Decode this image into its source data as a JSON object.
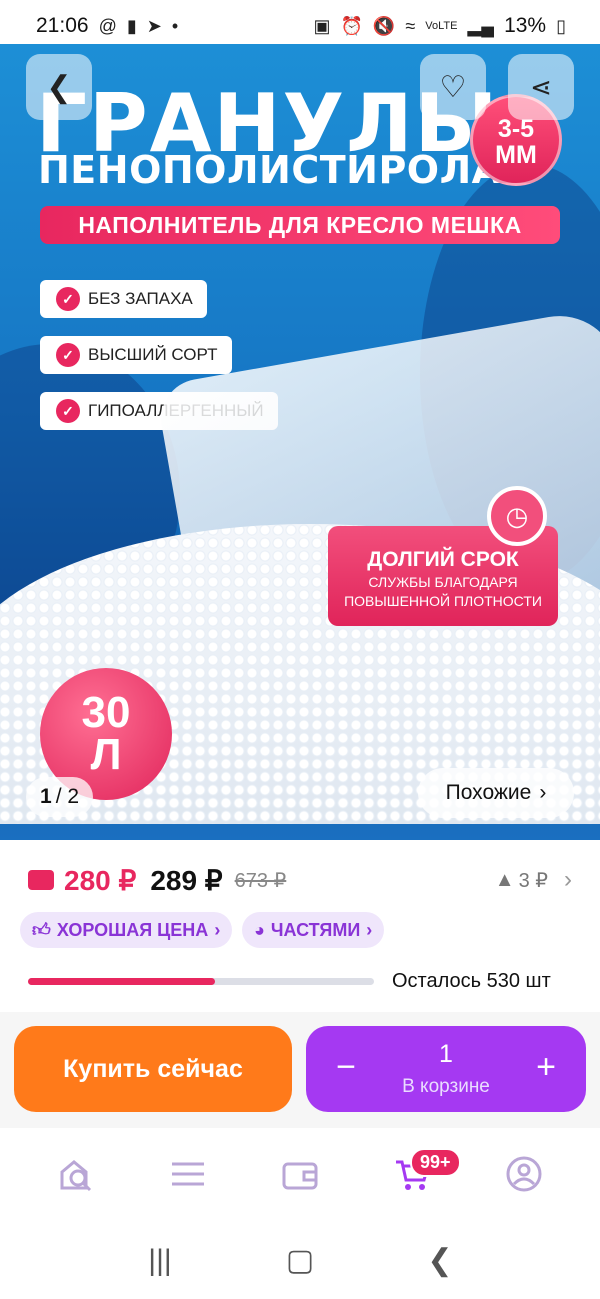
{
  "status_bar": {
    "time": "21:06",
    "battery": "13%",
    "icons_left": [
      "at-icon",
      "alert-icon",
      "telegram-icon",
      "dot-icon"
    ],
    "icons_right": [
      "battery-saver-icon",
      "alarm-icon",
      "mute-icon",
      "wifi-icon",
      "volte-icon",
      "signal-icon",
      "battery-icon"
    ]
  },
  "hero": {
    "title_line1": "ГРАНУЛЫ",
    "title_line2": "ПЕНОПОЛИСТИРОЛА",
    "size_badge": "3-5\nММ",
    "size_line1": "3-5",
    "size_line2": "ММ",
    "filler_banner": "НАПОЛНИТЕЛЬ ДЛЯ КРЕСЛО МЕШКА",
    "features": [
      "БЕЗ ЗАПАХА",
      "ВЫСШИЙ СОРТ",
      "ГИПОАЛЛЕРГЕННЫЙ"
    ],
    "long_title": "ДОЛГИЙ СРОК",
    "long_sub1": "СЛУЖБЫ БЛАГОДАРЯ",
    "long_sub2": "ПОВЫШЕННОЙ ПЛОТНОСТИ",
    "volume_num": "30",
    "volume_unit": "Л",
    "pager_current": "1",
    "pager_total": "/ 2",
    "similar_label": "Похожие"
  },
  "price": {
    "wallet_price": "280 ₽",
    "price": "289 ₽",
    "old_price": "673 ₽",
    "delta": "3 ₽"
  },
  "chips": {
    "good_price": "ХОРОШАЯ ЦЕНА",
    "installments": "ЧАСТЯМИ"
  },
  "stock": {
    "remaining_label": "Осталось 530 шт",
    "sold_fraction": 0.54
  },
  "actions": {
    "buy_now": "Купить сейчас",
    "quantity": "1",
    "in_cart": "В корзине"
  },
  "bottom_nav": {
    "cart_badge": "99+",
    "items": [
      "search-home-icon",
      "catalog-icon",
      "wallet-icon",
      "cart-icon",
      "profile-icon"
    ]
  },
  "colors": {
    "accent_pink": "#e8275f",
    "buy_orange": "#ff7a1a",
    "cart_purple": "#a539f2",
    "chip_purple": "#8a34d6"
  }
}
